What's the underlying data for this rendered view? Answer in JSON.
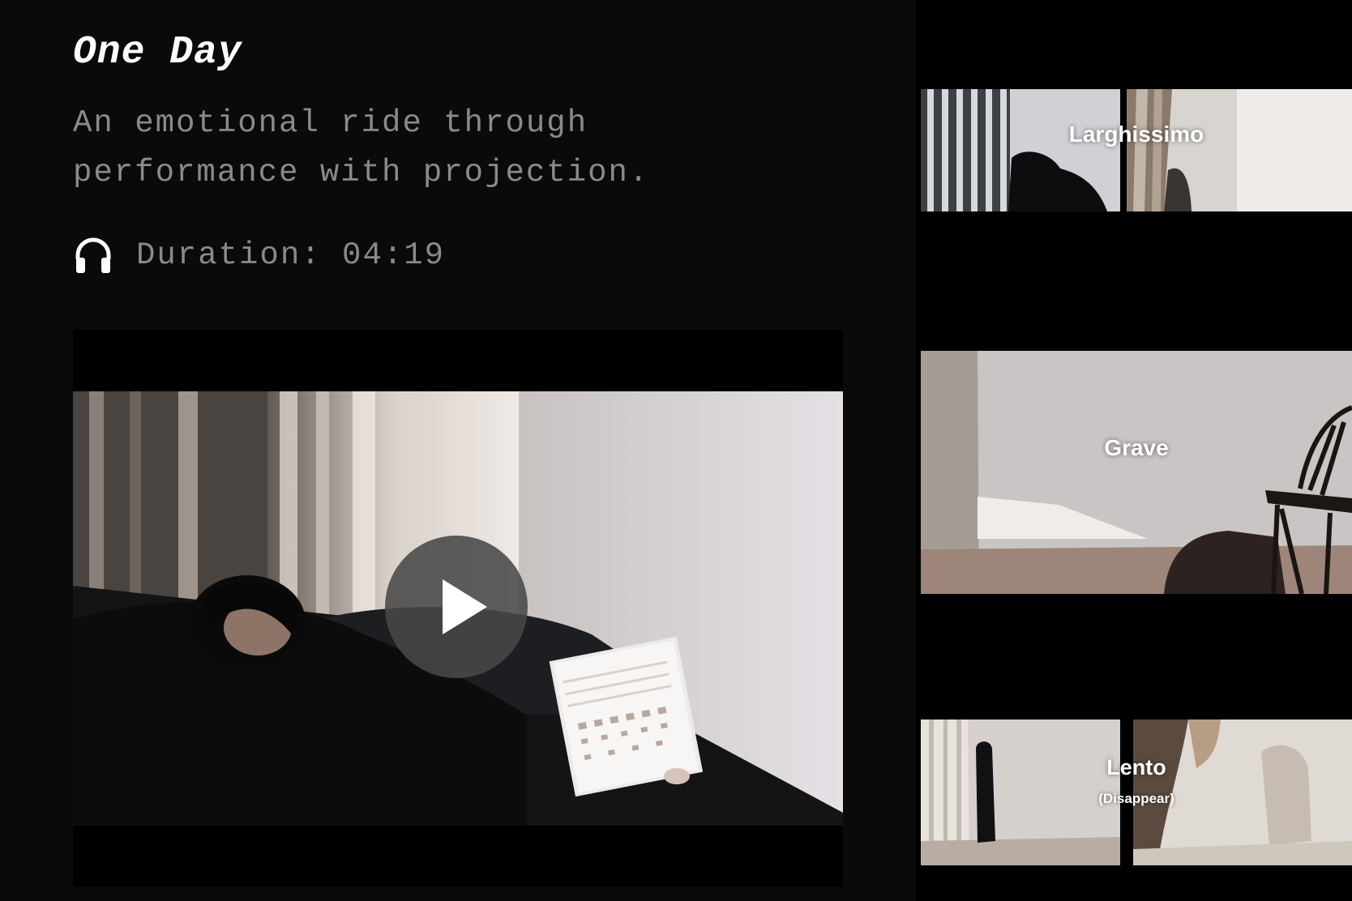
{
  "project": {
    "title": "One Day",
    "description": "An emotional ride through\nperformance with projection.",
    "duration_label": "Duration: 04:19",
    "duration_icon": "headphones-icon"
  },
  "player": {
    "play_icon": "play-icon"
  },
  "gallery": {
    "items": [
      {
        "label": "Larghissimo",
        "sublabel": ""
      },
      {
        "label": "Grave",
        "sublabel": ""
      },
      {
        "label": "Lento",
        "sublabel": "(Disappear)"
      }
    ]
  },
  "colors": {
    "background": "#0a0a0b",
    "panel": "#000000",
    "title_text": "#ffffff",
    "body_text": "#8a8a8a",
    "play_button": "#484848"
  }
}
